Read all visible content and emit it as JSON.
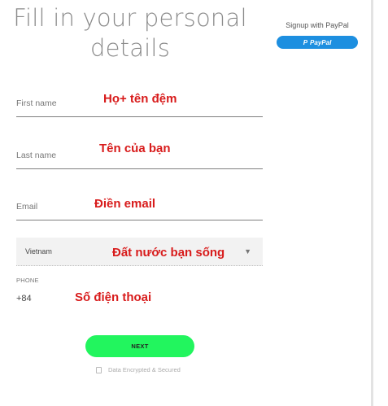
{
  "header": {
    "title_line1": "Fill in your personal",
    "title_line2": "details"
  },
  "paypal": {
    "signup_label": "Signup with PayPal",
    "button_label": "PayPal",
    "button_icon": "paypal-p-icon"
  },
  "form": {
    "first_name": {
      "placeholder": "First name",
      "annotation": "Họ+ tên đệm"
    },
    "last_name": {
      "placeholder": "Last name",
      "annotation": "Tên của bạn"
    },
    "email": {
      "placeholder": "Email",
      "annotation": "Điền email"
    },
    "country": {
      "value": "Vietnam",
      "annotation": "Đất nước bạn sống",
      "arrow_icon": "chevron-down-icon"
    },
    "phone": {
      "label": "PHONE",
      "country_code": "+84",
      "annotation": "Số điện thoại"
    }
  },
  "actions": {
    "next_label": "NEXT",
    "secure_text": "Data Encrypted & Secured"
  },
  "colors": {
    "next_button": "#22f55e",
    "paypal_button": "#1d8fe0",
    "annotation_text": "#d81b1b"
  }
}
